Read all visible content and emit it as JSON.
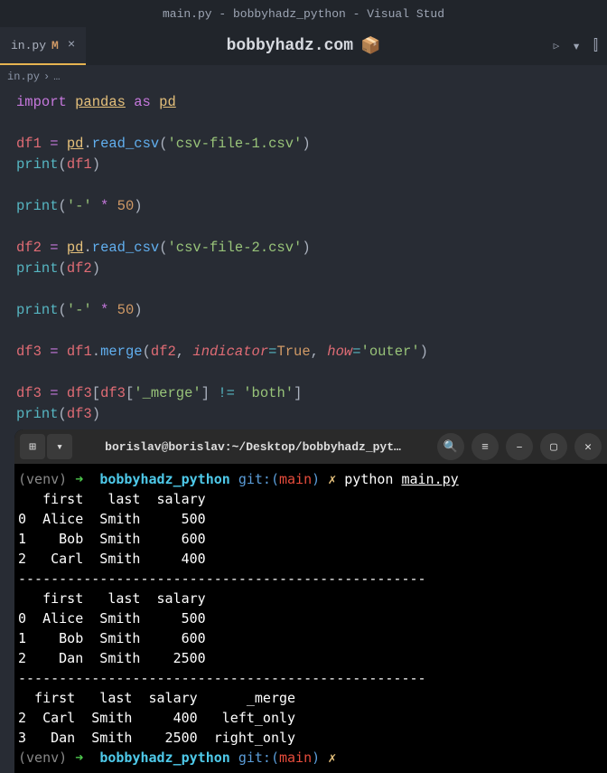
{
  "titlebar": "main.py - bobbyhadz_python - Visual Stud",
  "tab": {
    "name": "in.py",
    "modified": "M",
    "close": "×"
  },
  "header": {
    "title": "bobbyhadz.com",
    "box": "📦"
  },
  "breadcrumb": {
    "file": "in.py",
    "sep": "›",
    "dots": "…"
  },
  "code": {
    "l1_import": "import",
    "l1_pandas": "pandas",
    "l1_as": "as",
    "l1_pd": "pd",
    "l3_df1": "df1",
    "l3_eq": "=",
    "l3_pd": "pd",
    "l3_dot": ".",
    "l3_read": "read_csv",
    "l3_str": "'csv-file-1.csv'",
    "l4_print": "print",
    "l4_arg": "df1",
    "l6_print": "print",
    "l6_str": "'-'",
    "l6_star": "*",
    "l6_num": "50",
    "l8_df2": "df2",
    "l8_eq": "=",
    "l8_pd": "pd",
    "l8_dot": ".",
    "l8_read": "read_csv",
    "l8_str": "'csv-file-2.csv'",
    "l9_print": "print",
    "l9_arg": "df2",
    "l11_print": "print",
    "l11_str": "'-'",
    "l11_star": "*",
    "l11_num": "50",
    "l13_df3": "df3",
    "l13_eq": "=",
    "l13_df1": "df1",
    "l13_dot": ".",
    "l13_merge": "merge",
    "l13_df2": "df2",
    "l13_c1": ",",
    "l13_ind": "indicator",
    "l13_eq2": "=",
    "l13_true": "True",
    "l13_c2": ",",
    "l13_how": "how",
    "l13_eq3": "=",
    "l13_outer": "'outer'",
    "l15_df3": "df3",
    "l15_eq": "=",
    "l15_df3b": "df3",
    "l15_lb": "[",
    "l15_df3c": "df3",
    "l15_lb2": "[",
    "l15_merge": "'_merge'",
    "l15_rb": "]",
    "l15_ne": "!=",
    "l15_both": "'both'",
    "l15_rb2": "]",
    "l16_print": "print",
    "l16_arg": "df3"
  },
  "terminal": {
    "title": "borislav@borislav:~/Desktop/bobbyhadz_pyt…",
    "prompt1": {
      "venv": "(venv)",
      "arrow": "➜",
      "dir": "bobbyhadz_python",
      "git": "git:(",
      "branch": "main",
      "git2": ")",
      "x": "✗",
      "cmd": "python",
      "file": "main.py"
    },
    "out1_h": "   first   last  salary",
    "out1_r0": "0  Alice  Smith     500",
    "out1_r1": "1    Bob  Smith     600",
    "out1_r2": "2   Carl  Smith     400",
    "sep1": "--------------------------------------------------",
    "out2_h": "   first   last  salary",
    "out2_r0": "0  Alice  Smith     500",
    "out2_r1": "1    Bob  Smith     600",
    "out2_r2": "2    Dan  Smith    2500",
    "sep2": "--------------------------------------------------",
    "out3_h": "  first   last  salary      _merge",
    "out3_r2": "2  Carl  Smith     400   left_only",
    "out3_r3": "3   Dan  Smith    2500  right_only",
    "prompt2": {
      "venv": "(venv)",
      "arrow": "➜",
      "dir": "bobbyhadz_python",
      "git": "git:(",
      "branch": "main",
      "git2": ")",
      "x": "✗"
    }
  },
  "icons": {
    "run": "▷",
    "split": "⫿",
    "more": "⋯",
    "newtab": "⊞",
    "dropdown": "▾",
    "search": "🔍",
    "menu": "≡",
    "min": "–",
    "max": "▢",
    "close": "✕"
  }
}
